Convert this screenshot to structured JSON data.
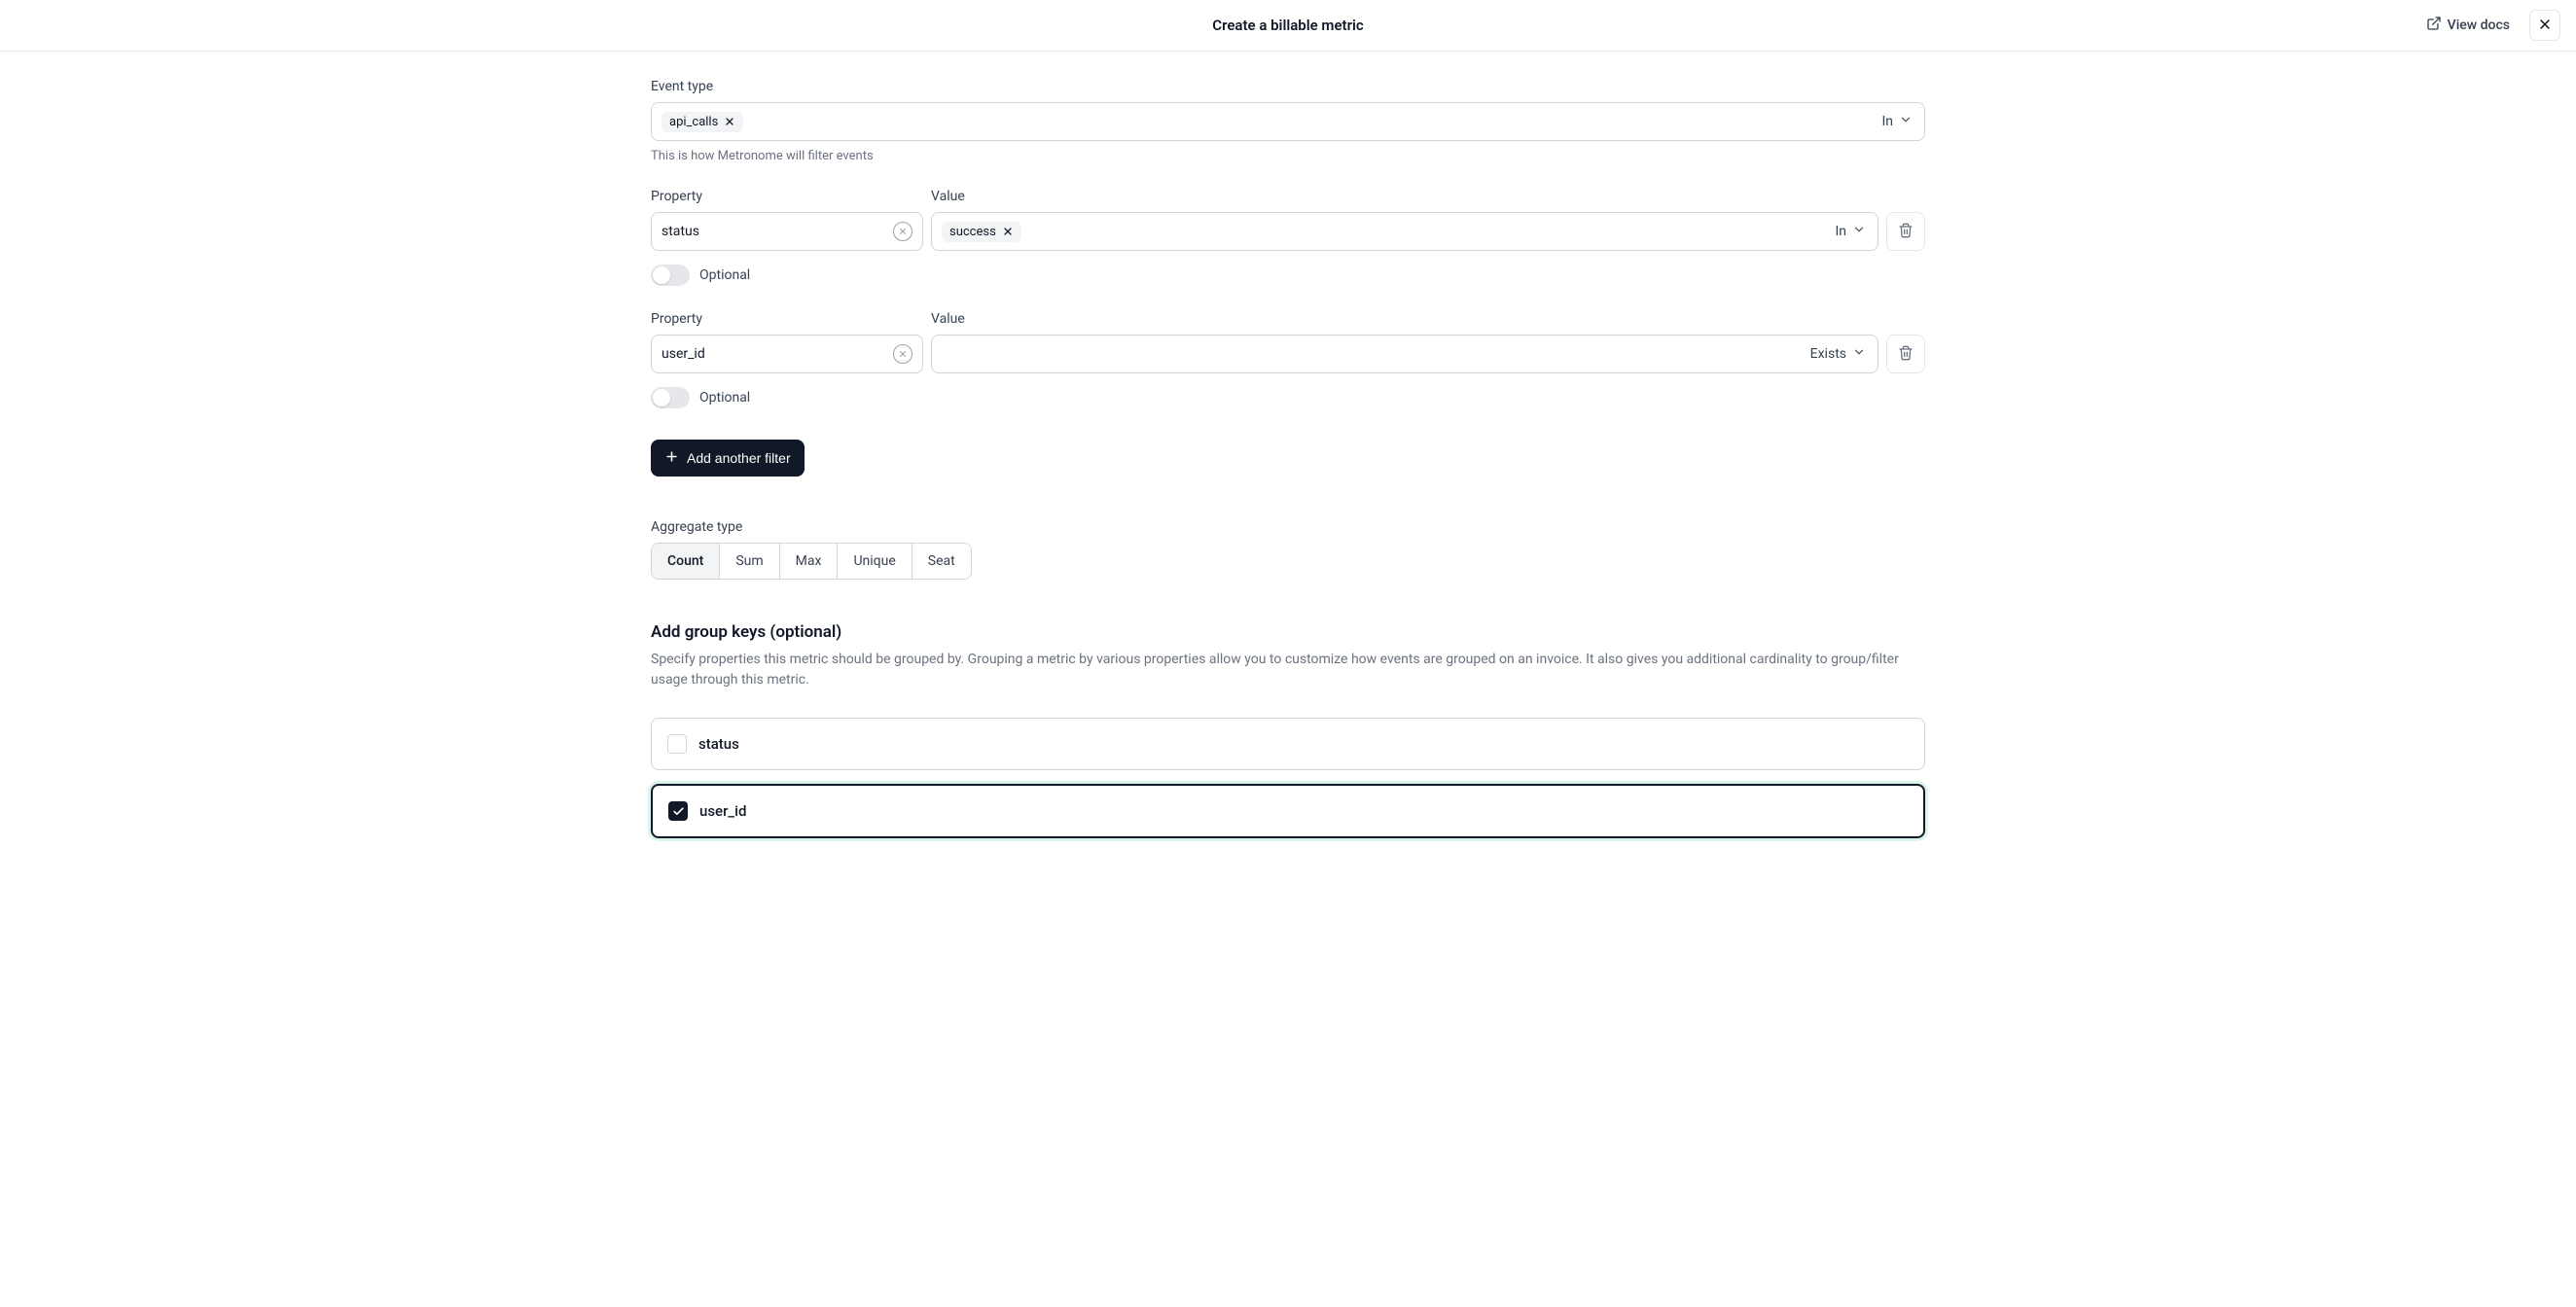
{
  "header": {
    "title": "Create a billable metric",
    "view_docs": "View docs"
  },
  "event_type": {
    "label": "Event type",
    "chip": "api_calls",
    "operator": "In",
    "helper": "This is how Metronome will filter events"
  },
  "filters": [
    {
      "property_label": "Property",
      "value_label": "Value",
      "property": "status",
      "value_chip": "success",
      "operator": "In",
      "optional_label": "Optional"
    },
    {
      "property_label": "Property",
      "value_label": "Value",
      "property": "user_id",
      "value_chip": "",
      "operator": "Exists",
      "optional_label": "Optional"
    }
  ],
  "add_filter": "Add another filter",
  "aggregate": {
    "label": "Aggregate type",
    "options": [
      "Count",
      "Sum",
      "Max",
      "Unique",
      "Seat"
    ],
    "selected": "Count"
  },
  "group_keys": {
    "title": "Add group keys (optional)",
    "description": "Specify properties this metric should be grouped by. Grouping a metric by various properties allow you to customize how events are grouped on an invoice. It also gives you additional cardinality to group/filter usage through this metric.",
    "items": [
      {
        "label": "status",
        "checked": false
      },
      {
        "label": "user_id",
        "checked": true
      }
    ]
  }
}
